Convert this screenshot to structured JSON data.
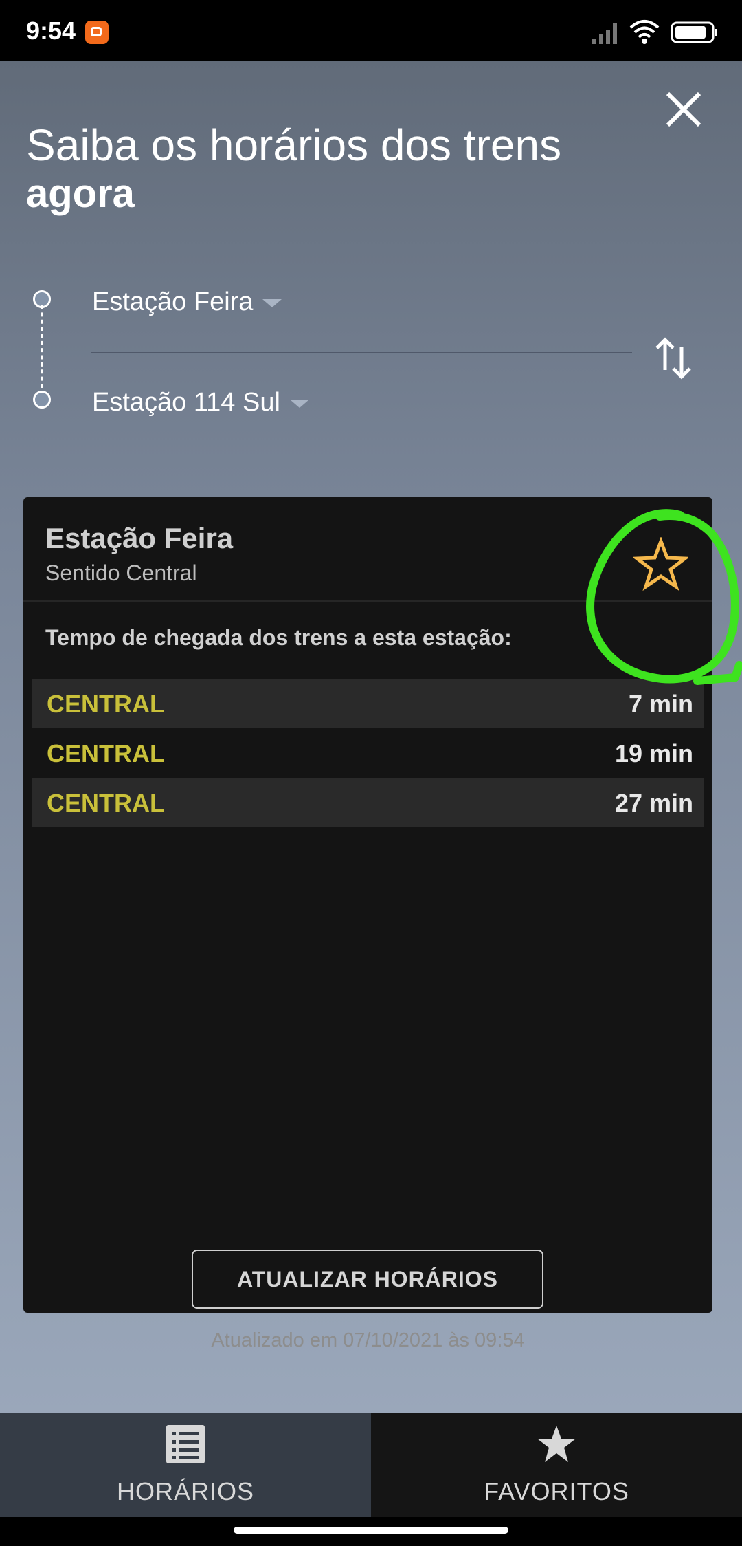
{
  "status_bar": {
    "time": "9:54"
  },
  "header": {
    "title_line1": "Saiba os horários dos trens",
    "title_line2": "agora"
  },
  "route": {
    "origin": "Estação Feira",
    "destination": "Estação 114 Sul"
  },
  "card": {
    "station": "Estação Feira",
    "direction": "Sentido Central",
    "arrival_title": "Tempo de chegada dos trens a esta estação:",
    "arrivals": [
      {
        "destination": "CENTRAL",
        "time": "7 min"
      },
      {
        "destination": "CENTRAL",
        "time": "19 min"
      },
      {
        "destination": "CENTRAL",
        "time": "27 min"
      }
    ],
    "refresh_label": "ATUALIZAR HORÁRIOS",
    "updated_text": "Atualizado em 07/10/2021 às 09:54"
  },
  "colors": {
    "star": "#f5b84c",
    "destination_text": "#c9c03a",
    "highlight": "#3ee31f"
  },
  "tabs": [
    {
      "label": "HORÁRIOS",
      "icon": "list-icon",
      "active": true
    },
    {
      "label": "FAVORITOS",
      "icon": "star-icon",
      "active": false
    }
  ]
}
